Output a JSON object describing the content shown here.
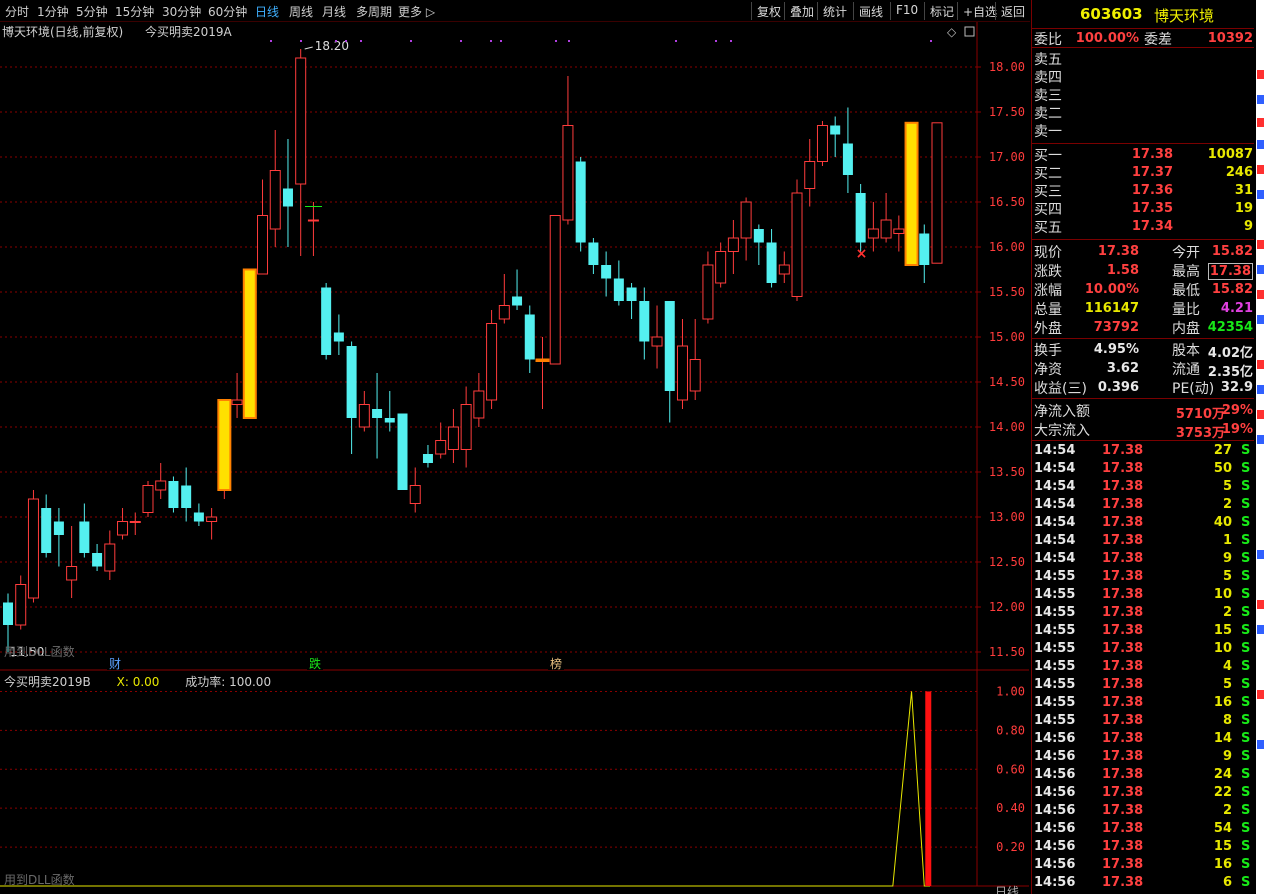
{
  "toolbar": {
    "periods": [
      "分时",
      "1分钟",
      "5分钟",
      "15分钟",
      "30分钟",
      "60分钟",
      "日线",
      "周线",
      "月线",
      "多周期",
      "更多"
    ],
    "active_period": "日线",
    "right_buttons": [
      "复权",
      "叠加",
      "统计",
      "画线",
      "F10",
      "标记",
      "+自选",
      "返回"
    ]
  },
  "chart_title": {
    "stock": "博天环境(日线,前复权)",
    "formula": "今买明卖2019A"
  },
  "sub_title": {
    "formula": "今买明卖2019B",
    "x_label": "X: 0.00",
    "rate_label": "成功率: 100.00"
  },
  "labels": {
    "high_mark": "18.20",
    "low_mark": "11.50",
    "dll_note_main": "用到DLL函数",
    "dll_note_sub": "用到DLL函数",
    "date_box": "日线",
    "event_cai": "财",
    "event_die": "跌",
    "event_bang": "榜",
    "sell_mark": "×"
  },
  "colors": {
    "up": "#ff3c3c",
    "down": "#54f0f0",
    "signal_fill": "#ffe000",
    "signal_edge": "#ff8000",
    "grid": "#8a0000",
    "axis_text": "#ff3c3c"
  },
  "chart_data": [
    {
      "type": "candlestick",
      "title": "博天环境(日线,前复权) 今买明卖2019A",
      "ylim": [
        11.3,
        18.5
      ],
      "y_ticks": [
        "18.00",
        "17.50",
        "17.00",
        "16.50",
        "16.00",
        "15.50",
        "15.00",
        "14.50",
        "14.00",
        "13.50",
        "13.00",
        "12.50",
        "12.00",
        "11.50"
      ],
      "signal_bars": [
        17,
        19,
        42,
        71
      ],
      "ohlc": [
        [
          12.05,
          11.8,
          12.15,
          11.5
        ],
        [
          11.8,
          12.25,
          12.35,
          11.75
        ],
        [
          12.1,
          13.2,
          13.3,
          12.05
        ],
        [
          13.1,
          12.6,
          13.25,
          12.55
        ],
        [
          12.95,
          12.8,
          13.1,
          12.45
        ],
        [
          12.3,
          12.45,
          12.9,
          12.1
        ],
        [
          12.95,
          12.6,
          13.15,
          12.55
        ],
        [
          12.6,
          12.45,
          12.7,
          12.4
        ],
        [
          12.4,
          12.7,
          12.85,
          12.3
        ],
        [
          12.8,
          12.95,
          13.1,
          12.75
        ],
        [
          12.95,
          12.95,
          13.05,
          12.8
        ],
        [
          13.05,
          13.35,
          13.4,
          13.0
        ],
        [
          13.3,
          13.4,
          13.6,
          13.2
        ],
        [
          13.4,
          13.1,
          13.45,
          13.05
        ],
        [
          13.35,
          13.1,
          13.55,
          12.95
        ],
        [
          13.05,
          12.95,
          13.15,
          12.9
        ],
        [
          12.95,
          13.0,
          13.1,
          12.75
        ],
        [
          13.3,
          14.3,
          14.3,
          13.2
        ],
        [
          14.25,
          14.3,
          14.6,
          14.1
        ],
        [
          14.1,
          15.75,
          15.75,
          14.1
        ],
        [
          15.7,
          16.35,
          16.75,
          15.7
        ],
        [
          16.2,
          16.85,
          17.3,
          16.0
        ],
        [
          16.65,
          16.45,
          17.2,
          16.0
        ],
        [
          16.7,
          18.1,
          18.2,
          15.9
        ],
        [
          16.3,
          16.3,
          16.5,
          15.9
        ],
        [
          15.55,
          14.8,
          15.6,
          14.75
        ],
        [
          15.05,
          14.95,
          15.25,
          14.8
        ],
        [
          14.9,
          14.1,
          14.95,
          13.7
        ],
        [
          14.0,
          14.25,
          14.4,
          13.95
        ],
        [
          14.2,
          14.1,
          14.6,
          13.65
        ],
        [
          14.1,
          14.05,
          14.4,
          13.95
        ],
        [
          14.15,
          13.3,
          14.15,
          13.3
        ],
        [
          13.15,
          13.35,
          13.55,
          13.05
        ],
        [
          13.7,
          13.6,
          13.8,
          13.55
        ],
        [
          13.7,
          13.85,
          14.05,
          13.65
        ],
        [
          13.75,
          14.0,
          14.2,
          13.6
        ],
        [
          13.75,
          14.25,
          14.45,
          13.55
        ],
        [
          14.1,
          14.4,
          14.6,
          14.0
        ],
        [
          14.3,
          15.15,
          15.3,
          14.2
        ],
        [
          15.2,
          15.35,
          15.7,
          15.15
        ],
        [
          15.45,
          15.35,
          15.75,
          15.3
        ],
        [
          15.25,
          14.75,
          15.35,
          14.6
        ],
        [
          14.75,
          14.75,
          15.0,
          14.2
        ],
        [
          14.7,
          16.35,
          16.35,
          14.7
        ],
        [
          16.3,
          17.35,
          17.9,
          16.25
        ],
        [
          16.95,
          16.05,
          17.0,
          15.95
        ],
        [
          16.05,
          15.8,
          16.1,
          15.7
        ],
        [
          15.8,
          15.65,
          15.95,
          15.45
        ],
        [
          15.65,
          15.4,
          15.85,
          15.35
        ],
        [
          15.55,
          15.4,
          15.6,
          15.2
        ],
        [
          15.4,
          14.95,
          15.55,
          14.75
        ],
        [
          14.9,
          15.0,
          15.35,
          14.65
        ],
        [
          15.4,
          14.4,
          15.4,
          14.05
        ],
        [
          14.3,
          14.9,
          15.2,
          14.2
        ],
        [
          14.4,
          14.75,
          15.2,
          14.3
        ],
        [
          15.2,
          15.8,
          15.95,
          15.15
        ],
        [
          15.6,
          15.95,
          16.05,
          15.55
        ],
        [
          15.95,
          16.1,
          16.3,
          15.7
        ],
        [
          16.1,
          16.5,
          16.55,
          15.85
        ],
        [
          16.2,
          16.05,
          16.25,
          15.8
        ],
        [
          16.05,
          15.6,
          16.2,
          15.55
        ],
        [
          15.7,
          15.8,
          15.95,
          15.6
        ],
        [
          15.45,
          16.6,
          16.75,
          15.4
        ],
        [
          16.65,
          16.95,
          17.2,
          16.45
        ],
        [
          16.95,
          17.35,
          17.4,
          16.9
        ],
        [
          17.35,
          17.25,
          17.45,
          17.0
        ],
        [
          17.15,
          16.8,
          17.55,
          16.6
        ],
        [
          16.6,
          16.05,
          16.7,
          15.95
        ],
        [
          16.1,
          16.2,
          16.5,
          15.95
        ],
        [
          16.1,
          16.3,
          16.6,
          16.05
        ],
        [
          16.15,
          16.2,
          16.35,
          15.95
        ],
        [
          15.8,
          17.38,
          17.38,
          15.82
        ],
        [
          16.15,
          15.8,
          16.25,
          15.6
        ],
        [
          15.82,
          17.38,
          17.38,
          15.82
        ]
      ]
    },
    {
      "type": "line",
      "title": "今买明卖2019B",
      "ylim": [
        0,
        1.1
      ],
      "y_ticks": [
        "1.00",
        "0.80",
        "0.60",
        "0.40",
        "0.20"
      ],
      "line_series": [
        {
          "x": 0,
          "y": 0
        },
        {
          "x": 71,
          "y": 0
        },
        {
          "x": 72,
          "y": 1.0
        },
        {
          "x": 73,
          "y": 0
        },
        {
          "x": 74,
          "y": 0
        }
      ],
      "bar_signal": {
        "x": 73,
        "value": 1.0
      }
    }
  ],
  "right_panel": {
    "code": "603603",
    "name": "博天环境",
    "weibi_label": "委比",
    "weibi_value": "100.00%",
    "weicha_label": "委差",
    "weicha_value": "10392",
    "sell_levels": [
      "卖五",
      "卖四",
      "卖三",
      "卖二",
      "卖一"
    ],
    "buy_levels": [
      {
        "label": "买一",
        "price": "17.38",
        "vol": "10087"
      },
      {
        "label": "买二",
        "price": "17.37",
        "vol": "246"
      },
      {
        "label": "买三",
        "price": "17.36",
        "vol": "31"
      },
      {
        "label": "买四",
        "price": "17.35",
        "vol": "19"
      },
      {
        "label": "买五",
        "price": "17.34",
        "vol": "9"
      }
    ],
    "stats": [
      {
        "l1": "现价",
        "v1": "17.38",
        "c1": "red",
        "l2": "今开",
        "v2": "15.82",
        "c2": "red",
        "b2": false
      },
      {
        "l1": "涨跌",
        "v1": "1.58",
        "c1": "red",
        "l2": "最高",
        "v2": "17.38",
        "c2": "red",
        "b2": true
      },
      {
        "l1": "涨幅",
        "v1": "10.00%",
        "c1": "red",
        "l2": "最低",
        "v2": "15.82",
        "c2": "red",
        "b2": false
      },
      {
        "l1": "总量",
        "v1": "116147",
        "c1": "yel",
        "l2": "量比",
        "v2": "4.21",
        "c2": "mag",
        "b2": false
      },
      {
        "l1": "外盘",
        "v1": "73792",
        "c1": "red",
        "l2": "内盘",
        "v2": "42354",
        "c2": "green",
        "b2": false
      }
    ],
    "stats2": [
      {
        "l1": "换手",
        "v1": "4.95%",
        "l2": "股本",
        "v2": "4.02亿"
      },
      {
        "l1": "净资",
        "v1": "3.62",
        "l2": "流通",
        "v2": "2.35亿"
      },
      {
        "l1": "收益(三)",
        "v1": "0.396",
        "l2": "PE(动)",
        "v2": "32.9"
      }
    ],
    "flows": [
      {
        "label": "净流入额",
        "value": "5710万",
        "pct": "29%"
      },
      {
        "label": "大宗流入",
        "value": "3753万",
        "pct": "19%"
      }
    ],
    "ticks": [
      {
        "t": "14:54",
        "p": "17.38",
        "v": "27",
        "s": "S"
      },
      {
        "t": "14:54",
        "p": "17.38",
        "v": "50",
        "s": "S"
      },
      {
        "t": "14:54",
        "p": "17.38",
        "v": "5",
        "s": "S"
      },
      {
        "t": "14:54",
        "p": "17.38",
        "v": "2",
        "s": "S"
      },
      {
        "t": "14:54",
        "p": "17.38",
        "v": "40",
        "s": "S"
      },
      {
        "t": "14:54",
        "p": "17.38",
        "v": "1",
        "s": "S"
      },
      {
        "t": "14:54",
        "p": "17.38",
        "v": "9",
        "s": "S"
      },
      {
        "t": "14:55",
        "p": "17.38",
        "v": "5",
        "s": "S"
      },
      {
        "t": "14:55",
        "p": "17.38",
        "v": "10",
        "s": "S"
      },
      {
        "t": "14:55",
        "p": "17.38",
        "v": "2",
        "s": "S"
      },
      {
        "t": "14:55",
        "p": "17.38",
        "v": "15",
        "s": "S"
      },
      {
        "t": "14:55",
        "p": "17.38",
        "v": "10",
        "s": "S"
      },
      {
        "t": "14:55",
        "p": "17.38",
        "v": "4",
        "s": "S"
      },
      {
        "t": "14:55",
        "p": "17.38",
        "v": "5",
        "s": "S"
      },
      {
        "t": "14:55",
        "p": "17.38",
        "v": "16",
        "s": "S"
      },
      {
        "t": "14:55",
        "p": "17.38",
        "v": "8",
        "s": "S"
      },
      {
        "t": "14:56",
        "p": "17.38",
        "v": "14",
        "s": "S"
      },
      {
        "t": "14:56",
        "p": "17.38",
        "v": "9",
        "s": "S"
      },
      {
        "t": "14:56",
        "p": "17.38",
        "v": "24",
        "s": "S"
      },
      {
        "t": "14:56",
        "p": "17.38",
        "v": "22",
        "s": "S"
      },
      {
        "t": "14:56",
        "p": "17.38",
        "v": "2",
        "s": "S"
      },
      {
        "t": "14:56",
        "p": "17.38",
        "v": "54",
        "s": "S"
      },
      {
        "t": "14:56",
        "p": "17.38",
        "v": "15",
        "s": "S"
      },
      {
        "t": "14:56",
        "p": "17.38",
        "v": "16",
        "s": "S"
      },
      {
        "t": "14:56",
        "p": "17.38",
        "v": "6",
        "s": "S"
      }
    ]
  }
}
